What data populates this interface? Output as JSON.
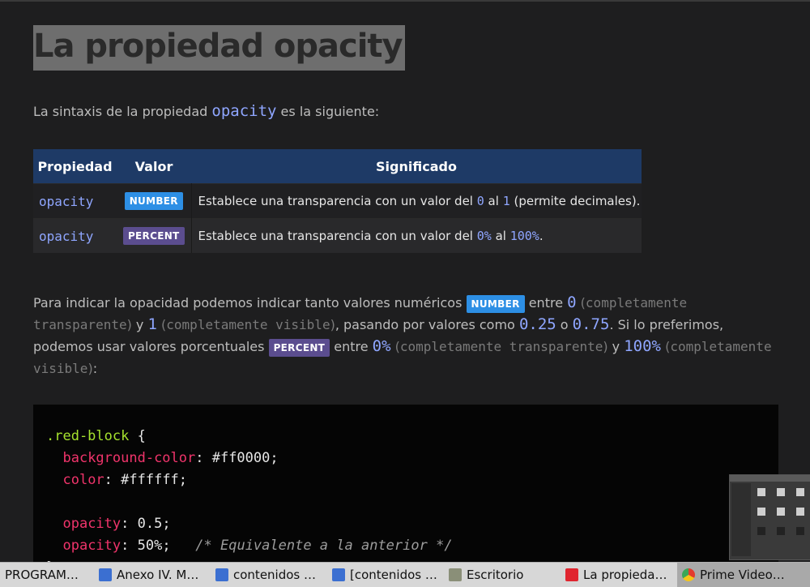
{
  "header": {
    "title": "La propiedad opacity"
  },
  "intro": {
    "text_before": "La sintaxis de la propiedad ",
    "code": "opacity",
    "text_after": " es la siguiente:"
  },
  "table": {
    "headers": [
      "Propiedad",
      "Valor",
      "Significado"
    ],
    "rows": [
      {
        "prop": "opacity",
        "badge": "NUMBER",
        "desc_a": "Establece una transparencia con un valor del ",
        "code1": "0",
        "desc_b": " al ",
        "code2": "1",
        "desc_c": " (permite decimales)."
      },
      {
        "prop": "opacity",
        "badge": "PERCENT",
        "desc_a": "Establece una transparencia con un valor del ",
        "code1": "0%",
        "desc_b": " al ",
        "code2": "100%",
        "desc_c": "."
      }
    ]
  },
  "paragraph": {
    "t1": "Para indicar la opacidad podemos indicar tanto valores numéricos ",
    "badge1": "NUMBER",
    "t2": " entre ",
    "v0": "0",
    "m1": "completamente transparente",
    "t3": " y ",
    "v1": "1",
    "m2": "completamente visible",
    "t4": ", pasando por valores como ",
    "v025": "0.25",
    "t5": " o ",
    "v075": "0.75",
    "t6": ". Si lo preferimos, podemos usar valores porcentuales ",
    "badge2": "PERCENT",
    "t7": " entre ",
    "p0": "0%",
    "m3": "completamente transparente",
    "t8": " y ",
    "p100": "100%",
    "m4": "completamente visible",
    "t9": ":"
  },
  "code": {
    "selector": ".red-block",
    "open_brace": " {",
    "l1_prop": "background-color",
    "l1_val": ": #ff0000;",
    "l2_prop": "color",
    "l2_val": ": #ffffff;",
    "l3_prop": "opacity",
    "l3_val": ": 0.5;",
    "l4_prop": "opacity",
    "l4_val": ": 50%;",
    "l4_comment": "/* Equivalente a la anterior */",
    "close_brace": "}"
  },
  "taskbar": {
    "items": [
      {
        "label": "PROGRAM…",
        "icon": "none"
      },
      {
        "label": "Anexo IV. M…",
        "icon": "document-icon"
      },
      {
        "label": "contenidos …",
        "icon": "document-icon"
      },
      {
        "label": "[contenidos …",
        "icon": "document-icon"
      },
      {
        "label": "Escritorio",
        "icon": "folder-icon"
      },
      {
        "label": "La propieda…",
        "icon": "vivaldi-icon"
      },
      {
        "label": "Prime Video…",
        "icon": "chrome-icon"
      }
    ]
  },
  "colors": {
    "background": "#1e1e1f",
    "table_header": "#1e3a66",
    "code_accent": "#8fa6ff",
    "badge_number": "#2d8fe5",
    "badge_percent": "#5b4d8f",
    "css_property": "#f0346b",
    "css_selector": "#a6e22e"
  }
}
